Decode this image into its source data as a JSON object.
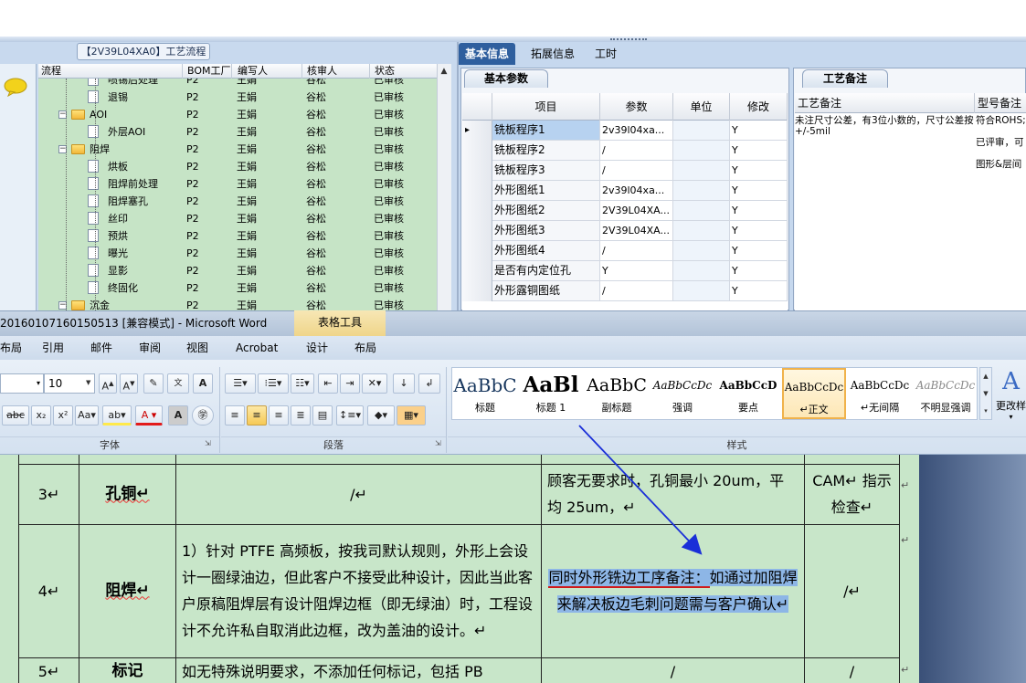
{
  "erp": {
    "panel_title": "【2V39L04XA0】工艺流程",
    "tree_columns": [
      "流程",
      "BOM工厂",
      "编写人",
      "核审人",
      "状态"
    ],
    "tree_rows": [
      {
        "name": "喷锡后处理",
        "bom": "P2",
        "writer": "王娟",
        "reviewer": "谷松",
        "status": "已审核",
        "indent": 3,
        "kind": "doc"
      },
      {
        "name": "退锡",
        "bom": "P2",
        "writer": "王娟",
        "reviewer": "谷松",
        "status": "已审核",
        "indent": 3,
        "kind": "doc"
      },
      {
        "name": "AOI",
        "bom": "P2",
        "writer": "王娟",
        "reviewer": "谷松",
        "status": "已审核",
        "indent": 2,
        "kind": "folder"
      },
      {
        "name": "外层AOI",
        "bom": "P2",
        "writer": "王娟",
        "reviewer": "谷松",
        "status": "已审核",
        "indent": 3,
        "kind": "doc"
      },
      {
        "name": "阻焊",
        "bom": "P2",
        "writer": "王娟",
        "reviewer": "谷松",
        "status": "已审核",
        "indent": 2,
        "kind": "folder"
      },
      {
        "name": "烘板",
        "bom": "P2",
        "writer": "王娟",
        "reviewer": "谷松",
        "status": "已审核",
        "indent": 3,
        "kind": "doc"
      },
      {
        "name": "阻焊前处理",
        "bom": "P2",
        "writer": "王娟",
        "reviewer": "谷松",
        "status": "已审核",
        "indent": 3,
        "kind": "doc"
      },
      {
        "name": "阻焊塞孔",
        "bom": "P2",
        "writer": "王娟",
        "reviewer": "谷松",
        "status": "已审核",
        "indent": 3,
        "kind": "doc"
      },
      {
        "name": "丝印",
        "bom": "P2",
        "writer": "王娟",
        "reviewer": "谷松",
        "status": "已审核",
        "indent": 3,
        "kind": "doc"
      },
      {
        "name": "预烘",
        "bom": "P2",
        "writer": "王娟",
        "reviewer": "谷松",
        "status": "已审核",
        "indent": 3,
        "kind": "doc"
      },
      {
        "name": "曝光",
        "bom": "P2",
        "writer": "王娟",
        "reviewer": "谷松",
        "status": "已审核",
        "indent": 3,
        "kind": "doc"
      },
      {
        "name": "显影",
        "bom": "P2",
        "writer": "王娟",
        "reviewer": "谷松",
        "status": "已审核",
        "indent": 3,
        "kind": "doc"
      },
      {
        "name": "终固化",
        "bom": "P2",
        "writer": "王娟",
        "reviewer": "谷松",
        "status": "已审核",
        "indent": 3,
        "kind": "doc"
      },
      {
        "name": "沉金",
        "bom": "P2",
        "writer": "王娟",
        "reviewer": "谷松",
        "status": "已审核",
        "indent": 2,
        "kind": "folder"
      }
    ],
    "tabs": [
      "基本信息",
      "拓展信息",
      "工时"
    ],
    "params_tab": "基本参数",
    "grid_columns": [
      "项目",
      "参数",
      "单位",
      "修改"
    ],
    "grid_rows": [
      {
        "item": "铣板程序1",
        "param": "2v39l04xa...",
        "unit": "",
        "mod": "Y"
      },
      {
        "item": "铣板程序2",
        "param": "/",
        "unit": "",
        "mod": "Y"
      },
      {
        "item": "铣板程序3",
        "param": "/",
        "unit": "",
        "mod": "Y"
      },
      {
        "item": "外形图纸1",
        "param": "2v39l04xa...",
        "unit": "",
        "mod": "Y"
      },
      {
        "item": "外形图纸2",
        "param": "2V39L04XA...",
        "unit": "",
        "mod": "Y"
      },
      {
        "item": "外形图纸3",
        "param": "2V39L04XA...",
        "unit": "",
        "mod": "Y"
      },
      {
        "item": "外形图纸4",
        "param": "/",
        "unit": "",
        "mod": "Y"
      },
      {
        "item": "是否有内定位孔",
        "param": "Y",
        "unit": "",
        "mod": "Y"
      },
      {
        "item": "外形露铜图纸",
        "param": "/",
        "unit": "",
        "mod": "Y"
      }
    ],
    "notes_tab": "工艺备注",
    "notes_columns": [
      "工艺备注",
      "型号备注"
    ],
    "notes_text_1": "未注尺寸公差，有3位小数的，尺寸公差按+/-5mil",
    "notes_text_2": "符合ROHS;",
    "notes_text_3": "已评审，可",
    "notes_text_4": "图形&层间"
  },
  "word": {
    "title": "20160107160150513 [兼容模式] - Microsoft Word",
    "context_tab": "表格工具",
    "menu": [
      "布局",
      "引用",
      "邮件",
      "审阅",
      "视图",
      "Acrobat",
      "设计",
      "布局"
    ],
    "font_size": "10",
    "group_labels": [
      "字体",
      "段落",
      "样式"
    ],
    "styles": [
      {
        "preview": "AaBbC",
        "name": "标题"
      },
      {
        "preview": "AaBl",
        "name": "标题 1"
      },
      {
        "preview": "AaBbC",
        "name": "副标题"
      },
      {
        "preview": "AaBbCcDc",
        "name": "强调"
      },
      {
        "preview": "AaBbCcD",
        "name": "要点"
      },
      {
        "preview": "AaBbCcDc",
        "name": "↵正文"
      },
      {
        "preview": "AaBbCcDc",
        "name": "↵无间隔"
      },
      {
        "preview": "AaBbCcDc",
        "name": "不明显强调"
      }
    ],
    "change_styles": "更改样",
    "table": [
      {
        "num": "3↵",
        "name": "孔铜↵",
        "c3": "/↵",
        "c4": "顾客无要求时，孔铜最小 20um，平均 25um，↵",
        "c5": "CAM↵ 指示检查↵"
      },
      {
        "num": "4↵",
        "name": "阻焊↵",
        "c3": "1）针对 PTFE 高频板，按我司默认规则，外形上会设计一圈绿油边，但此客户不接受此种设计，因此当此客户原稿阻焊层有设计阻焊边框（即无绿油）时，工程设计不允许私自取消此边框，改为盖油的设计。↵",
        "c4_part1": "同时外形铣边工序备注：",
        "c4_part2": "如通过加阻焊来解决板边毛刺问题需与客户确认↵",
        "c5": "/↵"
      },
      {
        "num": "5↵",
        "name": "标记",
        "c3": "如无特殊说明要求，不添加任何标记，包括 PB",
        "c4": "/",
        "c5": "/"
      }
    ]
  },
  "colors": {
    "tree_bg": "#c6e4c6",
    "tab_active": "#2f5f9e",
    "highlight": "#8db6e6",
    "annotation_arrow": "#1a2fd8",
    "annotation_underline": "#d01a1a"
  }
}
